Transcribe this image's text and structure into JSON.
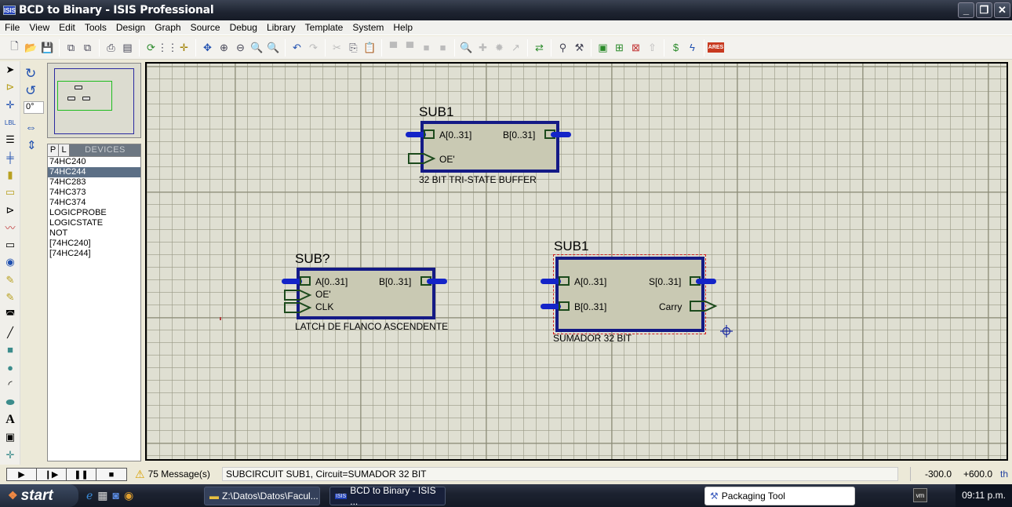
{
  "window": {
    "title": "BCD to Binary - ISIS Professional",
    "app_icon": "ISIS",
    "controls": [
      "minimize",
      "restore",
      "close"
    ]
  },
  "menu": [
    "File",
    "View",
    "Edit",
    "Tools",
    "Design",
    "Graph",
    "Source",
    "Debug",
    "Library",
    "Template",
    "System",
    "Help"
  ],
  "toolbar": {
    "icons": [
      "new-icon",
      "open-icon",
      "save-icon",
      "import-icon",
      "export-icon",
      "print-icon",
      "print-area-icon",
      "refresh-icon",
      "grid-icon",
      "origin-icon",
      "pan-icon",
      "zoom-in-icon",
      "zoom-out-icon",
      "zoom-all-icon",
      "zoom-area-icon",
      "undo-icon",
      "redo-icon",
      "cut-icon",
      "copy-icon",
      "paste-icon",
      "block-copy-icon",
      "block-move-icon",
      "block-rotate-icon",
      "block-delete-icon",
      "pick-device-icon",
      "make-device-icon",
      "packaging-tool-icon",
      "decompose-icon",
      "wire-autorouter-icon",
      "search-icon",
      "property-tool-icon",
      "new-sheet-icon",
      "add-sheet-icon",
      "remove-sheet-icon",
      "goto-child-icon",
      "bill-of-materials-icon",
      "electrical-rules-icon",
      "ares-icon"
    ],
    "ares_label": "ARES"
  },
  "rotation": {
    "value": "0°"
  },
  "device_panel": {
    "tab_p": "P",
    "tab_l": "L",
    "header": "DEVICES",
    "selected": "74HC244",
    "items": [
      "74HC240",
      "74HC244",
      "74HC283",
      "74HC373",
      "74HC374",
      "LOGICPROBE",
      "LOGICSTATE",
      "NOT",
      "[74HC240]",
      "[74HC244]"
    ]
  },
  "components": [
    {
      "ref": "SUB1",
      "desc": "32 BIT TRI-STATE BUFFER",
      "pins_left": [
        "A[0..31]",
        "OE'"
      ],
      "pins_right": [
        "B[0..31]"
      ]
    },
    {
      "ref": "SUB?",
      "desc": "LATCH DE FLANCO ASCENDENTE",
      "pins_left": [
        "A[0..31]",
        "OE'",
        "CLK"
      ],
      "pins_right": [
        "B[0..31]"
      ]
    },
    {
      "ref": "SUB1",
      "desc": "SUMADOR 32 BIT",
      "pins_left": [
        "A[0..31]",
        "B[0..31]"
      ],
      "pins_right": [
        "S[0..31]",
        "Carry"
      ],
      "selected": true
    }
  ],
  "status": {
    "messages": "75 Message(s)",
    "text": "SUBCIRCUIT SUB1, Circuit=SUMADOR 32 BIT",
    "x": "-300.0",
    "y": "+600.0",
    "units": "th"
  },
  "taskbar": {
    "start": "start",
    "tasks": [
      "Z:\\Datos\\Datos\\Facul...",
      "BCD to Binary - ISIS ...",
      "Packaging Tool"
    ],
    "tray": "vm",
    "clock": "09:11 p.m."
  }
}
